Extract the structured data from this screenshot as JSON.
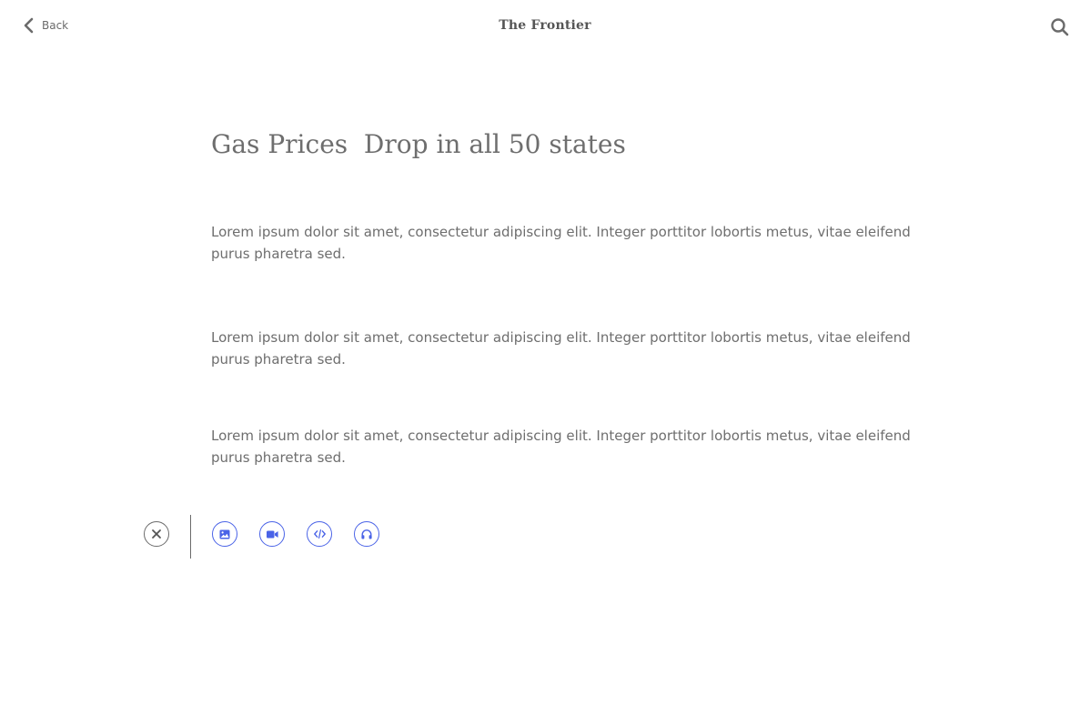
{
  "header": {
    "back_label": "Back",
    "brand": "The Frontier"
  },
  "article": {
    "title": "Gas Prices  Drop in all 50 states",
    "paragraphs": [
      "Lorem ipsum dolor sit amet, consectetur adipiscing elit. Integer porttitor lobortis metus, vitae eleifend purus pharetra sed.",
      "Lorem ipsum dolor sit amet, consectetur adipiscing elit. Integer porttitor lobortis metus, vitae eleifend purus pharetra sed.",
      "Lorem ipsum dolor sit amet, consectetur adipiscing elit. Integer porttitor lobortis metus, vitae eleifend purus pharetra sed."
    ]
  },
  "toolbar": {
    "buttons": [
      {
        "icon": "close-icon"
      },
      {
        "icon": "image-icon"
      },
      {
        "icon": "video-camera-icon"
      },
      {
        "icon": "code-icon"
      },
      {
        "icon": "headphones-icon"
      }
    ]
  },
  "colors": {
    "accent": "#4a63e7",
    "text": "#6e6e6e",
    "icon_gray": "#6b6b6b"
  }
}
